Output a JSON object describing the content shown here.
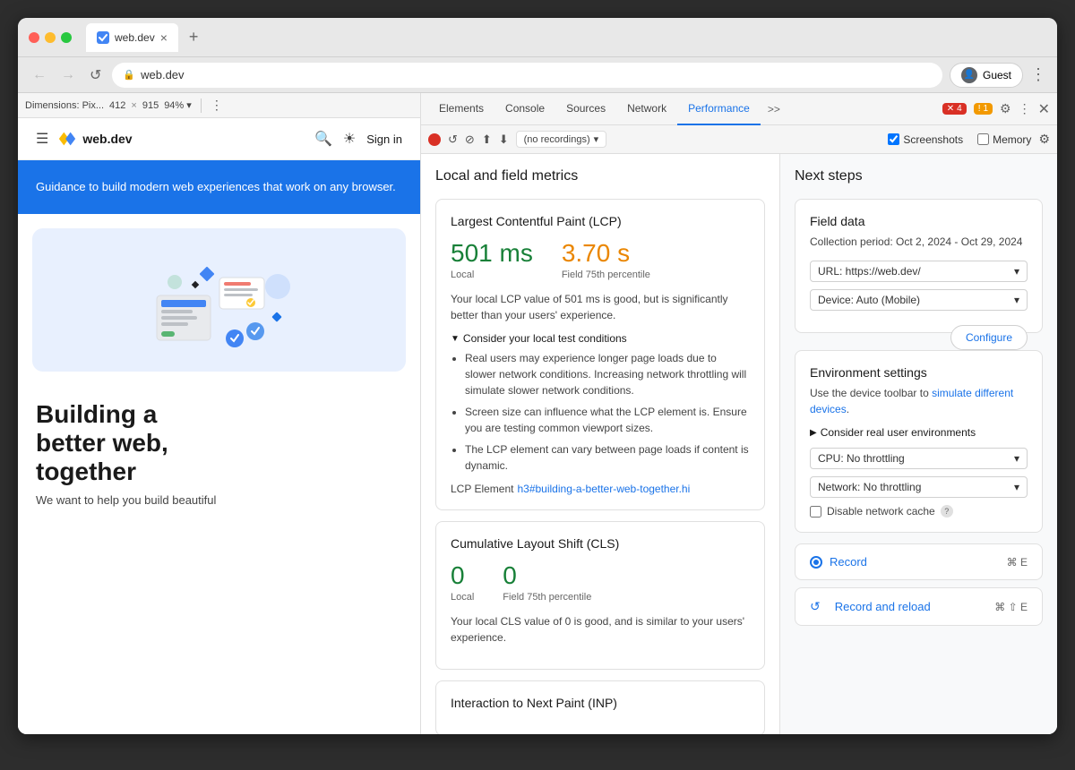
{
  "browser": {
    "title": "web.dev",
    "url": "web.dev",
    "tab_close": "×",
    "tab_new": "+",
    "profile_label": "Guest",
    "nav_back": "←",
    "nav_forward": "→",
    "nav_refresh": "↺",
    "menu_dots": "⋮"
  },
  "device_toolbar": {
    "dimensions_label": "Dimensions: Pix...",
    "width": "412",
    "cross": "×",
    "height": "915",
    "zoom": "94%",
    "zoom_arrow": "▾",
    "more_options": "⋮"
  },
  "site": {
    "nav": {
      "sign_in": "Sign in"
    },
    "hero_text": "Guidance to build modern web experiences that work on any browser.",
    "heading_line1": "Building a",
    "heading_line2": "better web,",
    "heading_line3": "together",
    "subtext": "We want to help you build beautiful"
  },
  "devtools": {
    "tabs": [
      {
        "label": "Elements",
        "active": false
      },
      {
        "label": "Console",
        "active": false
      },
      {
        "label": "Sources",
        "active": false
      },
      {
        "label": "Network",
        "active": false
      },
      {
        "label": "Performance",
        "active": true
      },
      {
        "label": ">>",
        "active": false
      }
    ],
    "error_count": "4",
    "warn_count": "1",
    "recording_bar": {
      "no_recordings": "(no recordings)",
      "dropdown_arrow": "▾",
      "screenshots_label": "Screenshots",
      "memory_label": "Memory"
    }
  },
  "metrics": {
    "section_title": "Local and field metrics",
    "lcp": {
      "title": "Largest Contentful Paint (LCP)",
      "local_value": "501 ms",
      "local_label": "Local",
      "field_value": "3.70 s",
      "field_label": "Field 75th percentile",
      "description": "Your local LCP value of 501 ms is good, but is significantly better than your users' experience.",
      "consider_title": "Consider your local test conditions",
      "bullets": [
        "Real users may experience longer page loads due to slower network conditions. Increasing network throttling will simulate slower network conditions.",
        "Screen size can influence what the LCP element is. Ensure you are testing common viewport sizes.",
        "The LCP element can vary between page loads if content is dynamic."
      ],
      "lcp_element_label": "LCP Element",
      "lcp_element_link": "h3#building-a-better-web-together.hi"
    },
    "cls": {
      "title": "Cumulative Layout Shift (CLS)",
      "local_value": "0",
      "local_label": "Local",
      "field_value": "0",
      "field_label": "Field 75th percentile",
      "description": "Your local CLS value of 0 is good, and is similar to your users' experience."
    },
    "inp": {
      "title": "Interaction to Next Paint (INP)"
    }
  },
  "next_steps": {
    "title": "Next steps",
    "field_data": {
      "title": "Field data",
      "collection_period": "Collection period: Oct 2, 2024 - Oct 29, 2024",
      "url_label": "URL: https://web.dev/",
      "url_arrow": "▾",
      "device_label": "Device: Auto (Mobile)",
      "device_arrow": "▾",
      "configure_btn": "Configure"
    },
    "environment": {
      "title": "Environment settings",
      "desc_before": "Use the device toolbar to ",
      "desc_link": "simulate different devices",
      "desc_after": ".",
      "consider_real": "Consider real user environments",
      "cpu_label": "CPU: No throttling",
      "cpu_arrow": "▾",
      "network_label": "Network: No throttling",
      "network_arrow": "▾",
      "disable_cache_label": "Disable network cache",
      "help": "?"
    },
    "record": {
      "record_label": "Record",
      "record_shortcut": "⌘ E",
      "record_reload_label": "Record and reload",
      "record_reload_shortcut": "⌘ ⇧ E"
    }
  }
}
